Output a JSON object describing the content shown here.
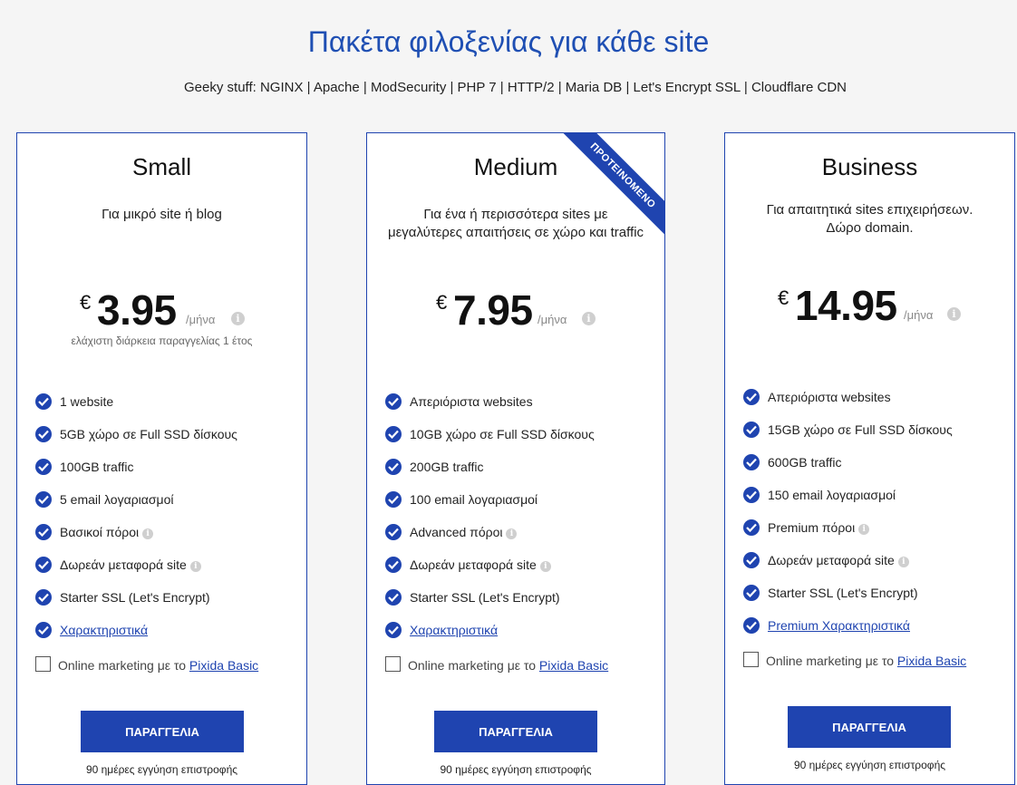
{
  "header": {
    "title": "Πακέτα φιλοξενίας για κάθε site",
    "tech_stack": "Geeky stuff: NGINX | Apache | ModSecurity | PHP 7 | HTTP/2 | Maria DB | Let's Encrypt SSL | Cloudflare CDN"
  },
  "plans": [
    {
      "name": "Small",
      "description": "Για μικρό site ή blog",
      "currency": "€",
      "price": "3.95",
      "period": "/μήνα",
      "info_glyph": "i",
      "min_duration": "ελάχιστη διάρκεια παραγγελίας 1 έτος",
      "features": [
        {
          "label": "1 website"
        },
        {
          "label": "5GB χώρο σε Full SSD δίσκους"
        },
        {
          "label": "100GB traffic"
        },
        {
          "label": "5 email λογαριασμοί"
        },
        {
          "label": "Βασικοί πόροι",
          "info": "i"
        },
        {
          "label": "Δωρεάν μεταφορά site",
          "info": "i"
        },
        {
          "label": "Starter SSL (Let's Encrypt)"
        },
        {
          "label": "Χαρακτηριστικά"
        }
      ],
      "addon": {
        "prefix": "Online marketing με το ",
        "link": "Pixida Basic"
      },
      "order_label": "ΠΑΡΑΓΓΕΛΙΑ",
      "guarantee": "90 ημέρες εγγύηση επιστροφής"
    },
    {
      "name": "Medium",
      "ribbon": "ΠΡΟΤΕΙΝΟΜΕΝΟ",
      "description_lines": [
        "Για ένα ή περισσότερα sites με",
        "μεγαλύτερες απαιτήσεις σε χώρο και traffic"
      ],
      "currency": "€",
      "price": "7.95",
      "period": "/μήνα",
      "info_glyph": "i",
      "features": [
        {
          "label": "Απεριόριστα websites"
        },
        {
          "label": "10GB χώρο σε Full SSD δίσκους"
        },
        {
          "label": "200GB traffic"
        },
        {
          "label": "100 email λογαριασμοί"
        },
        {
          "label": "Advanced πόροι",
          "info": "i"
        },
        {
          "label": "Δωρεάν μεταφορά site",
          "info": "i"
        },
        {
          "label": "Starter SSL (Let's Encrypt)"
        },
        {
          "label": "Χαρακτηριστικά"
        }
      ],
      "addon": {
        "prefix": "Online marketing με το ",
        "link": "Pixida Basic"
      },
      "order_label": "ΠΑΡΑΓΓΕΛΙΑ",
      "guarantee": "90 ημέρες εγγύηση επιστροφής"
    },
    {
      "name": "Business",
      "description_lines": [
        "Για απαιτητικά sites επιχειρήσεων.",
        "Δώρο domain."
      ],
      "currency": "€",
      "price": "14.95",
      "period": "/μήνα",
      "info_glyph": "i",
      "features": [
        {
          "label": "Απεριόριστα websites"
        },
        {
          "label": "15GB χώρο σε Full SSD δίσκους"
        },
        {
          "label": "600GB traffic"
        },
        {
          "label": "150 email λογαριασμοί"
        },
        {
          "label": "Premium πόροι",
          "info": "i"
        },
        {
          "label": "Δωρεάν μεταφορά site",
          "info": "i"
        },
        {
          "label": "Starter SSL (Let's Encrypt)"
        },
        {
          "label": "Premium Χαρακτηριστικά"
        }
      ],
      "addon": {
        "prefix": "Online marketing με το ",
        "link": "Pixida Basic"
      },
      "order_label": "ΠΑΡΑΓΓΕΛΙΑ",
      "guarantee": "90 ημέρες εγγύηση επιστροφής"
    }
  ],
  "colors": {
    "accent": "#1f44b0",
    "title": "#1f4fb3",
    "background": "#f5f5f5"
  }
}
